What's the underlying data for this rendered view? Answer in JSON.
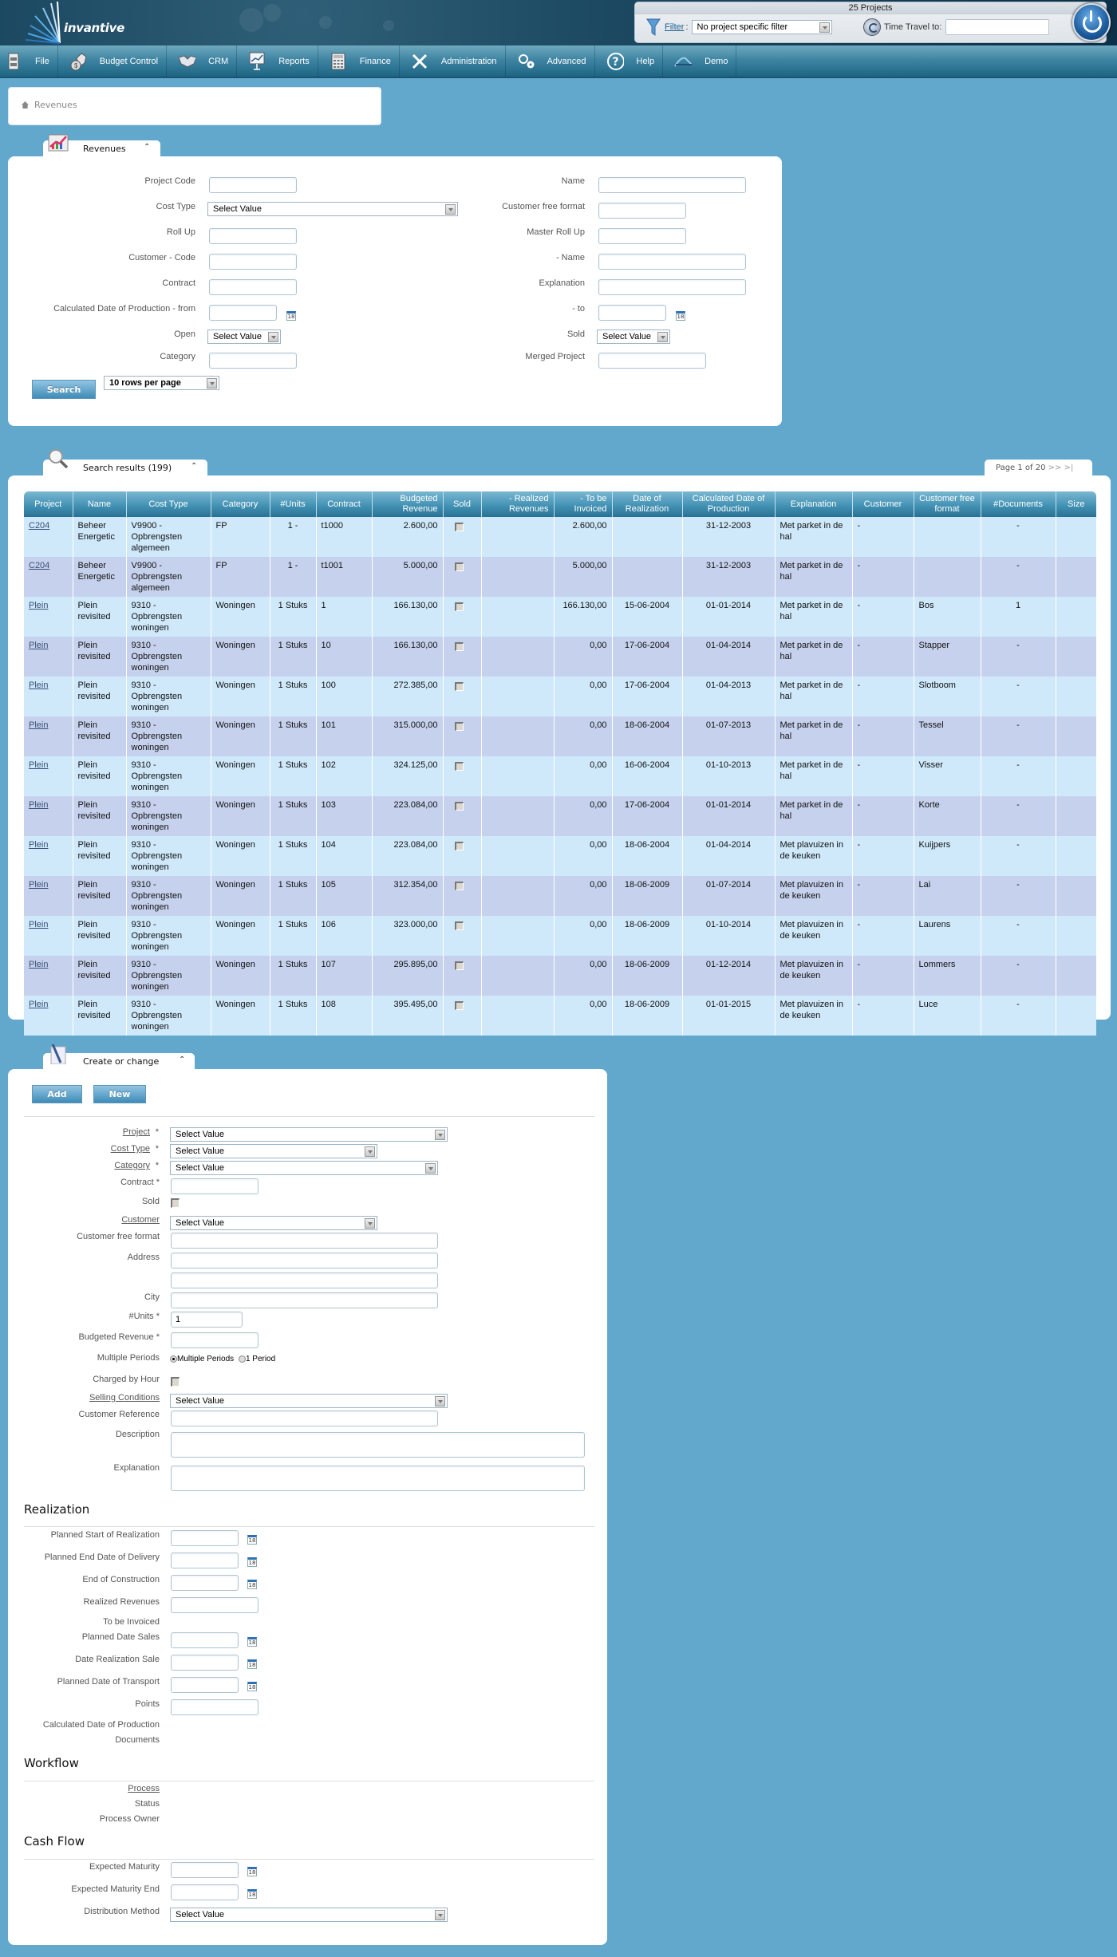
{
  "header": {
    "logo_text": "invantive",
    "project_count": "25 Projects",
    "filter_link": "Filter",
    "filter_colon": ":",
    "filter_value": "No project specific filter",
    "time_travel_label": "Time Travel to:",
    "time_travel_value": ""
  },
  "nav": {
    "items": [
      {
        "label": "File",
        "icon": "file-cabinet-icon"
      },
      {
        "label": "Budget Control",
        "icon": "money-bag-icon"
      },
      {
        "label": "CRM",
        "icon": "handshake-icon"
      },
      {
        "label": "Reports",
        "icon": "presentation-icon"
      },
      {
        "label": "Finance",
        "icon": "calculator-icon"
      },
      {
        "label": "Administration",
        "icon": "tools-icon"
      },
      {
        "label": "Advanced",
        "icon": "gears-icon"
      },
      {
        "label": "Help",
        "icon": "help-icon"
      },
      {
        "label": "Demo",
        "icon": "demo-icon"
      }
    ]
  },
  "breadcrumb": {
    "current": "Revenues"
  },
  "search_panel": {
    "tab_title": "Revenues",
    "left_fields": [
      {
        "label": "Project Code",
        "value": ""
      },
      {
        "label": "Cost Type",
        "value": "Select Value"
      },
      {
        "label": "Roll Up",
        "value": ""
      },
      {
        "label": "Customer - Code",
        "value": ""
      },
      {
        "label": "Contract",
        "value": ""
      },
      {
        "label": "Calculated Date of Production - from",
        "value": ""
      },
      {
        "label": "Open",
        "value": "Select Value"
      },
      {
        "label": "Category",
        "value": ""
      }
    ],
    "right_fields": [
      {
        "label": "Name",
        "value": ""
      },
      {
        "label": "Customer free format",
        "value": ""
      },
      {
        "label": "Master Roll Up",
        "value": ""
      },
      {
        "label": "- Name",
        "value": ""
      },
      {
        "label": "Explanation",
        "value": ""
      },
      {
        "label": "- to",
        "value": ""
      },
      {
        "label": "Sold",
        "value": "Select Value"
      },
      {
        "label": "Merged Project",
        "value": ""
      }
    ],
    "search_button": "Search",
    "rows_per_page": "10 rows per page",
    "calendar_day": "18"
  },
  "results": {
    "tab_title": "Search results (199)",
    "pager_text": "Page 1 of 20",
    "pager_next": ">>",
    "pager_last": ">|",
    "columns": [
      "Project",
      "Name",
      "Cost Type",
      "Category",
      "#Units",
      "Contract",
      "Budgeted Revenue",
      "Sold",
      "- Realized Revenues",
      "- To be Invoiced",
      "Date of Realization",
      "Calculated Date of Production",
      "Explanation",
      "Customer",
      "Customer free format",
      "#Documents",
      "Size"
    ],
    "rows": [
      {
        "project": "C204",
        "name": "Beheer Energetic",
        "cost_type": "V9900 - Opbrengsten algemeen",
        "category": "FP",
        "units": "1 -",
        "contract": "t1000",
        "budgeted": "2.600,00",
        "sold": false,
        "realized": "",
        "to_invoice": "2.600,00",
        "date_real": "",
        "calc_date": "31-12-2003",
        "explanation": "Met parket in de hal",
        "customer": "-",
        "cust_free": "",
        "docs": "-",
        "size": ""
      },
      {
        "project": "C204",
        "name": "Beheer Energetic",
        "cost_type": "V9900 - Opbrengsten algemeen",
        "category": "FP",
        "units": "1 -",
        "contract": "t1001",
        "budgeted": "5.000,00",
        "sold": false,
        "realized": "",
        "to_invoice": "5.000,00",
        "date_real": "",
        "calc_date": "31-12-2003",
        "explanation": "Met parket in de hal",
        "customer": "-",
        "cust_free": "",
        "docs": "-",
        "size": ""
      },
      {
        "project": "Plein",
        "name": "Plein revisited",
        "cost_type": "9310 - Opbrengsten woningen",
        "category": "Woningen",
        "units": "1 Stuks",
        "contract": "1",
        "budgeted": "166.130,00",
        "sold": false,
        "realized": "",
        "to_invoice": "166.130,00",
        "date_real": "15-06-2004",
        "calc_date": "01-01-2014",
        "explanation": "Met parket in de hal",
        "customer": "-",
        "cust_free": "Bos",
        "docs": "1",
        "size": ""
      },
      {
        "project": "Plein",
        "name": "Plein revisited",
        "cost_type": "9310 - Opbrengsten woningen",
        "category": "Woningen",
        "units": "1 Stuks",
        "contract": "10",
        "budgeted": "166.130,00",
        "sold": false,
        "realized": "",
        "to_invoice": "0,00",
        "date_real": "17-06-2004",
        "calc_date": "01-04-2014",
        "explanation": "Met parket in de hal",
        "customer": "-",
        "cust_free": "Stapper",
        "docs": "-",
        "size": ""
      },
      {
        "project": "Plein",
        "name": "Plein revisited",
        "cost_type": "9310 - Opbrengsten woningen",
        "category": "Woningen",
        "units": "1 Stuks",
        "contract": "100",
        "budgeted": "272.385,00",
        "sold": false,
        "realized": "",
        "to_invoice": "0,00",
        "date_real": "17-06-2004",
        "calc_date": "01-04-2013",
        "explanation": "Met parket in de hal",
        "customer": "-",
        "cust_free": "Slotboom",
        "docs": "-",
        "size": ""
      },
      {
        "project": "Plein",
        "name": "Plein revisited",
        "cost_type": "9310 - Opbrengsten woningen",
        "category": "Woningen",
        "units": "1 Stuks",
        "contract": "101",
        "budgeted": "315.000,00",
        "sold": false,
        "realized": "",
        "to_invoice": "0,00",
        "date_real": "18-06-2004",
        "calc_date": "01-07-2013",
        "explanation": "Met parket in de hal",
        "customer": "-",
        "cust_free": "Tessel",
        "docs": "-",
        "size": ""
      },
      {
        "project": "Plein",
        "name": "Plein revisited",
        "cost_type": "9310 - Opbrengsten woningen",
        "category": "Woningen",
        "units": "1 Stuks",
        "contract": "102",
        "budgeted": "324.125,00",
        "sold": false,
        "realized": "",
        "to_invoice": "0,00",
        "date_real": "16-06-2004",
        "calc_date": "01-10-2013",
        "explanation": "Met parket in de hal",
        "customer": "-",
        "cust_free": "Visser",
        "docs": "-",
        "size": ""
      },
      {
        "project": "Plein",
        "name": "Plein revisited",
        "cost_type": "9310 - Opbrengsten woningen",
        "category": "Woningen",
        "units": "1 Stuks",
        "contract": "103",
        "budgeted": "223.084,00",
        "sold": false,
        "realized": "",
        "to_invoice": "0,00",
        "date_real": "17-06-2004",
        "calc_date": "01-01-2014",
        "explanation": "Met parket in de hal",
        "customer": "-",
        "cust_free": "Korte",
        "docs": "-",
        "size": ""
      },
      {
        "project": "Plein",
        "name": "Plein revisited",
        "cost_type": "9310 - Opbrengsten woningen",
        "category": "Woningen",
        "units": "1 Stuks",
        "contract": "104",
        "budgeted": "223.084,00",
        "sold": false,
        "realized": "",
        "to_invoice": "0,00",
        "date_real": "18-06-2004",
        "calc_date": "01-04-2014",
        "explanation": "Met plavuizen in de keuken",
        "customer": "-",
        "cust_free": "Kuijpers",
        "docs": "-",
        "size": ""
      },
      {
        "project": "Plein",
        "name": "Plein revisited",
        "cost_type": "9310 - Opbrengsten woningen",
        "category": "Woningen",
        "units": "1 Stuks",
        "contract": "105",
        "budgeted": "312.354,00",
        "sold": false,
        "realized": "",
        "to_invoice": "0,00",
        "date_real": "18-06-2009",
        "calc_date": "01-07-2014",
        "explanation": "Met plavuizen in de keuken",
        "customer": "-",
        "cust_free": "Lai",
        "docs": "-",
        "size": ""
      },
      {
        "project": "Plein",
        "name": "Plein revisited",
        "cost_type": "9310 - Opbrengsten woningen",
        "category": "Woningen",
        "units": "1 Stuks",
        "contract": "106",
        "budgeted": "323.000,00",
        "sold": false,
        "realized": "",
        "to_invoice": "0,00",
        "date_real": "18-06-2009",
        "calc_date": "01-10-2014",
        "explanation": "Met plavuizen in de keuken",
        "customer": "-",
        "cust_free": "Laurens",
        "docs": "-",
        "size": ""
      },
      {
        "project": "Plein",
        "name": "Plein revisited",
        "cost_type": "9310 - Opbrengsten woningen",
        "category": "Woningen",
        "units": "1 Stuks",
        "contract": "107",
        "budgeted": "295.895,00",
        "sold": false,
        "realized": "",
        "to_invoice": "0,00",
        "date_real": "18-06-2009",
        "calc_date": "01-12-2014",
        "explanation": "Met plavuizen in de keuken",
        "customer": "-",
        "cust_free": "Lommers",
        "docs": "-",
        "size": ""
      },
      {
        "project": "Plein",
        "name": "Plein revisited",
        "cost_type": "9310 - Opbrengsten woningen",
        "category": "Woningen",
        "units": "1 Stuks",
        "contract": "108",
        "budgeted": "395.495,00",
        "sold": false,
        "realized": "",
        "to_invoice": "0,00",
        "date_real": "18-06-2009",
        "calc_date": "01-01-2015",
        "explanation": "Met plavuizen in de keuken",
        "customer": "-",
        "cust_free": "Luce",
        "docs": "-",
        "size": ""
      }
    ]
  },
  "create_panel": {
    "tab_title": "Create or change",
    "add_button": "Add",
    "new_button": "New",
    "fields": {
      "project": {
        "label": "Project",
        "required": "*",
        "value": "Select Value"
      },
      "cost_type": {
        "label": "Cost Type",
        "required": "*",
        "value": "Select Value"
      },
      "category": {
        "label": "Category",
        "required": "*",
        "value": "Select Value"
      },
      "contract": {
        "label": "Contract *",
        "value": ""
      },
      "sold": {
        "label": "Sold",
        "checked": false
      },
      "customer": {
        "label": "Customer",
        "value": "Select Value"
      },
      "customer_free_format": {
        "label": "Customer free format",
        "value": ""
      },
      "address": {
        "label": "Address",
        "line1": "",
        "line2": ""
      },
      "city": {
        "label": "City",
        "value": ""
      },
      "units": {
        "label": "#Units *",
        "value": "1"
      },
      "budgeted_revenue": {
        "label": "Budgeted Revenue *",
        "value": ""
      },
      "multiple_periods": {
        "label": "Multiple Periods",
        "option1": "Multiple Periods",
        "option2": "1 Period",
        "selected": "Multiple Periods"
      },
      "charged_by_hour": {
        "label": "Charged by Hour",
        "checked": false
      },
      "selling_conditions": {
        "label": "Selling Conditions",
        "value": "Select Value"
      },
      "customer_reference": {
        "label": "Customer Reference",
        "value": ""
      },
      "description": {
        "label": "Description",
        "value": ""
      },
      "explanation": {
        "label": "Explanation",
        "value": ""
      }
    },
    "realization": {
      "heading": "Realization",
      "planned_start": "Planned Start of Realization",
      "planned_end": "Planned End Date of Delivery",
      "end_construction": "End of Construction",
      "realized_revenues": "Realized Revenues",
      "to_be_invoiced": "To be Invoiced",
      "planned_date_sales": "Planned Date Sales",
      "date_realization_sale": "Date Realization Sale",
      "planned_transport": "Planned Date of Transport",
      "points": "Points",
      "calc_date_production": "Calculated Date of Production",
      "documents": "Documents"
    },
    "workflow": {
      "heading": "Workflow",
      "process": "Process",
      "status": "Status",
      "process_owner": "Process Owner"
    },
    "cash_flow": {
      "heading": "Cash Flow",
      "expected_maturity": "Expected Maturity",
      "expected_maturity_end": "Expected Maturity End",
      "distribution_method": "Distribution Method",
      "distribution_value": "Select Value"
    }
  }
}
